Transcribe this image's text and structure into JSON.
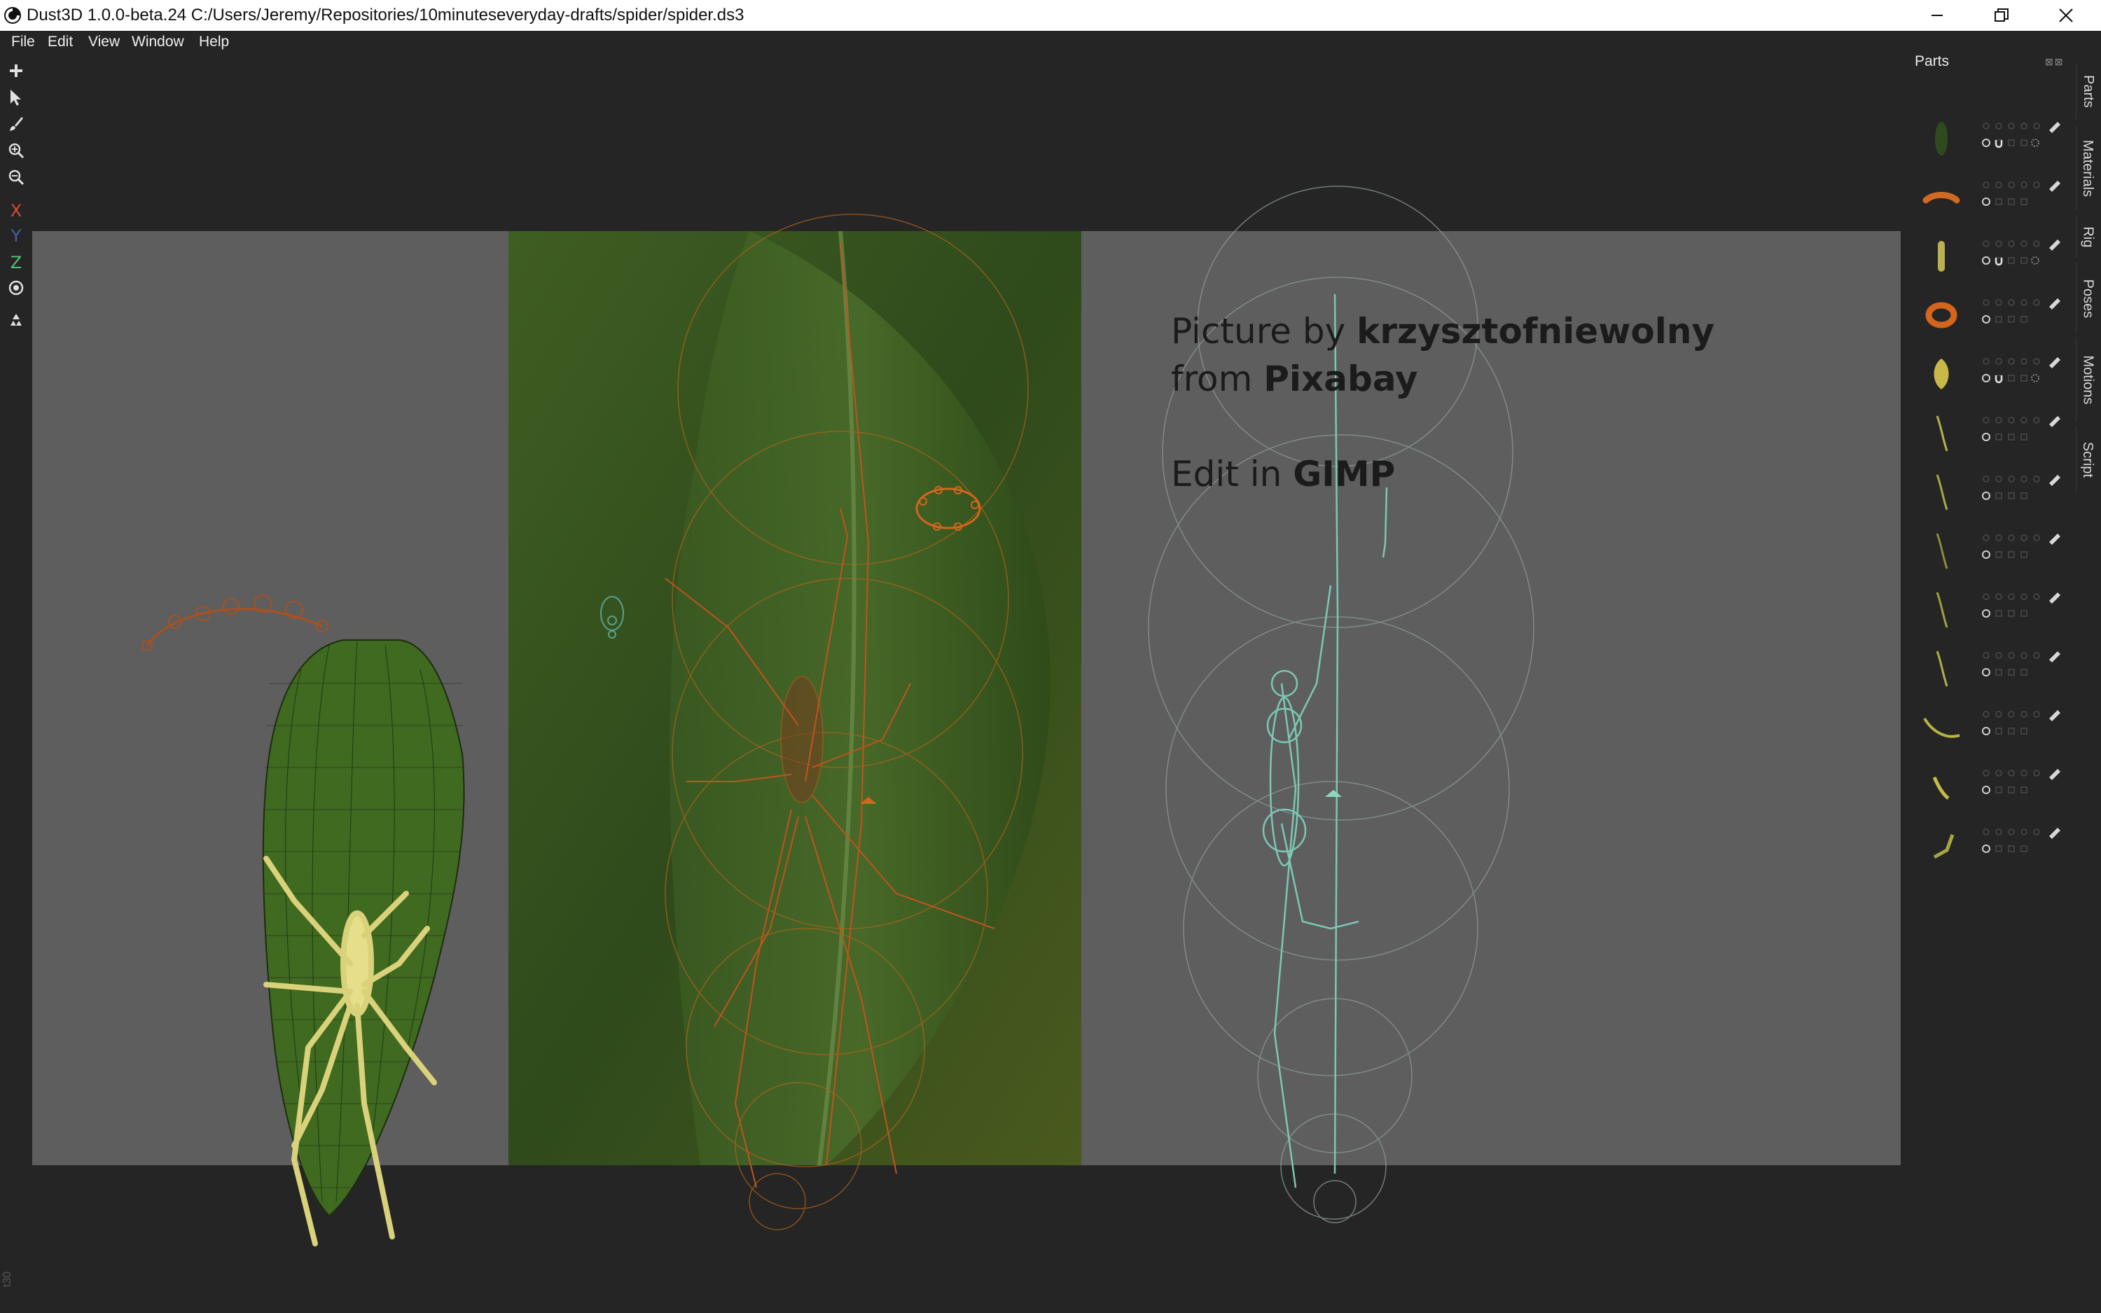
{
  "window": {
    "title": "Dust3D 1.0.0-beta.24 C:/Users/Jeremy/Repositories/10minuteseveryday-drafts/spider/spider.ds3",
    "minimize_icon": "minimize-icon",
    "restore_icon": "restore-icon",
    "close_icon": "close-icon"
  },
  "menu": {
    "items": [
      "File",
      "Edit",
      "View",
      "Window",
      "Help"
    ]
  },
  "toolbar": {
    "tools": [
      {
        "name": "add-icon",
        "glyph": "+"
      },
      {
        "name": "select-cursor-icon",
        "glyph": "➤"
      },
      {
        "name": "paint-brush-icon",
        "glyph": "🖌"
      },
      {
        "name": "zoom-in-icon",
        "glyph": "⊕"
      },
      {
        "name": "zoom-out-icon",
        "glyph": "⊖"
      }
    ],
    "axes": [
      {
        "label": "X",
        "color": "#d94a3a"
      },
      {
        "label": "Y",
        "color": "#4a5fa8"
      },
      {
        "label": "Z",
        "color": "#4fc27a"
      }
    ],
    "radius_icon": "radius-icon",
    "recycle_icon": "recycle-icon"
  },
  "canvas": {
    "credit_line1_prefix": "Picture by ",
    "credit_author": "krzysztofniewolny",
    "credit_line2_prefix": "from ",
    "credit_source": "Pixabay",
    "credit_line3_prefix": "Edit in ",
    "credit_tool": "GIMP"
  },
  "parts_panel": {
    "title": "Parts",
    "parts": [
      {
        "thumb": "leaf-dark",
        "color": "#2f4a1c",
        "locked": true
      },
      {
        "thumb": "spider-body-orange",
        "color": "#d06a22",
        "locked": false
      },
      {
        "thumb": "stick-yellow",
        "color": "#b9b050",
        "locked": true
      },
      {
        "thumb": "spider-ring-orange",
        "color": "#d4651d",
        "locked": false
      },
      {
        "thumb": "blob-yellow",
        "color": "#c8b84a",
        "locked": true
      },
      {
        "thumb": "leg",
        "color": "#b5b24a",
        "locked": false
      },
      {
        "thumb": "leg",
        "color": "#a8a846",
        "locked": false
      },
      {
        "thumb": "leg",
        "color": "#8a8c3a",
        "locked": false
      },
      {
        "thumb": "leg",
        "color": "#a0a040",
        "locked": false
      },
      {
        "thumb": "leg",
        "color": "#b0b04a",
        "locked": false
      },
      {
        "thumb": "leg-curved",
        "color": "#b5b445",
        "locked": false
      },
      {
        "thumb": "leg-short",
        "color": "#c1bc48",
        "locked": false
      },
      {
        "thumb": "leg-bent",
        "color": "#a9a63f",
        "locked": false
      }
    ]
  },
  "side_tabs": [
    "Parts",
    "Materials",
    "Rig",
    "Poses",
    "Motions",
    "Script"
  ],
  "corner_label": "t30"
}
